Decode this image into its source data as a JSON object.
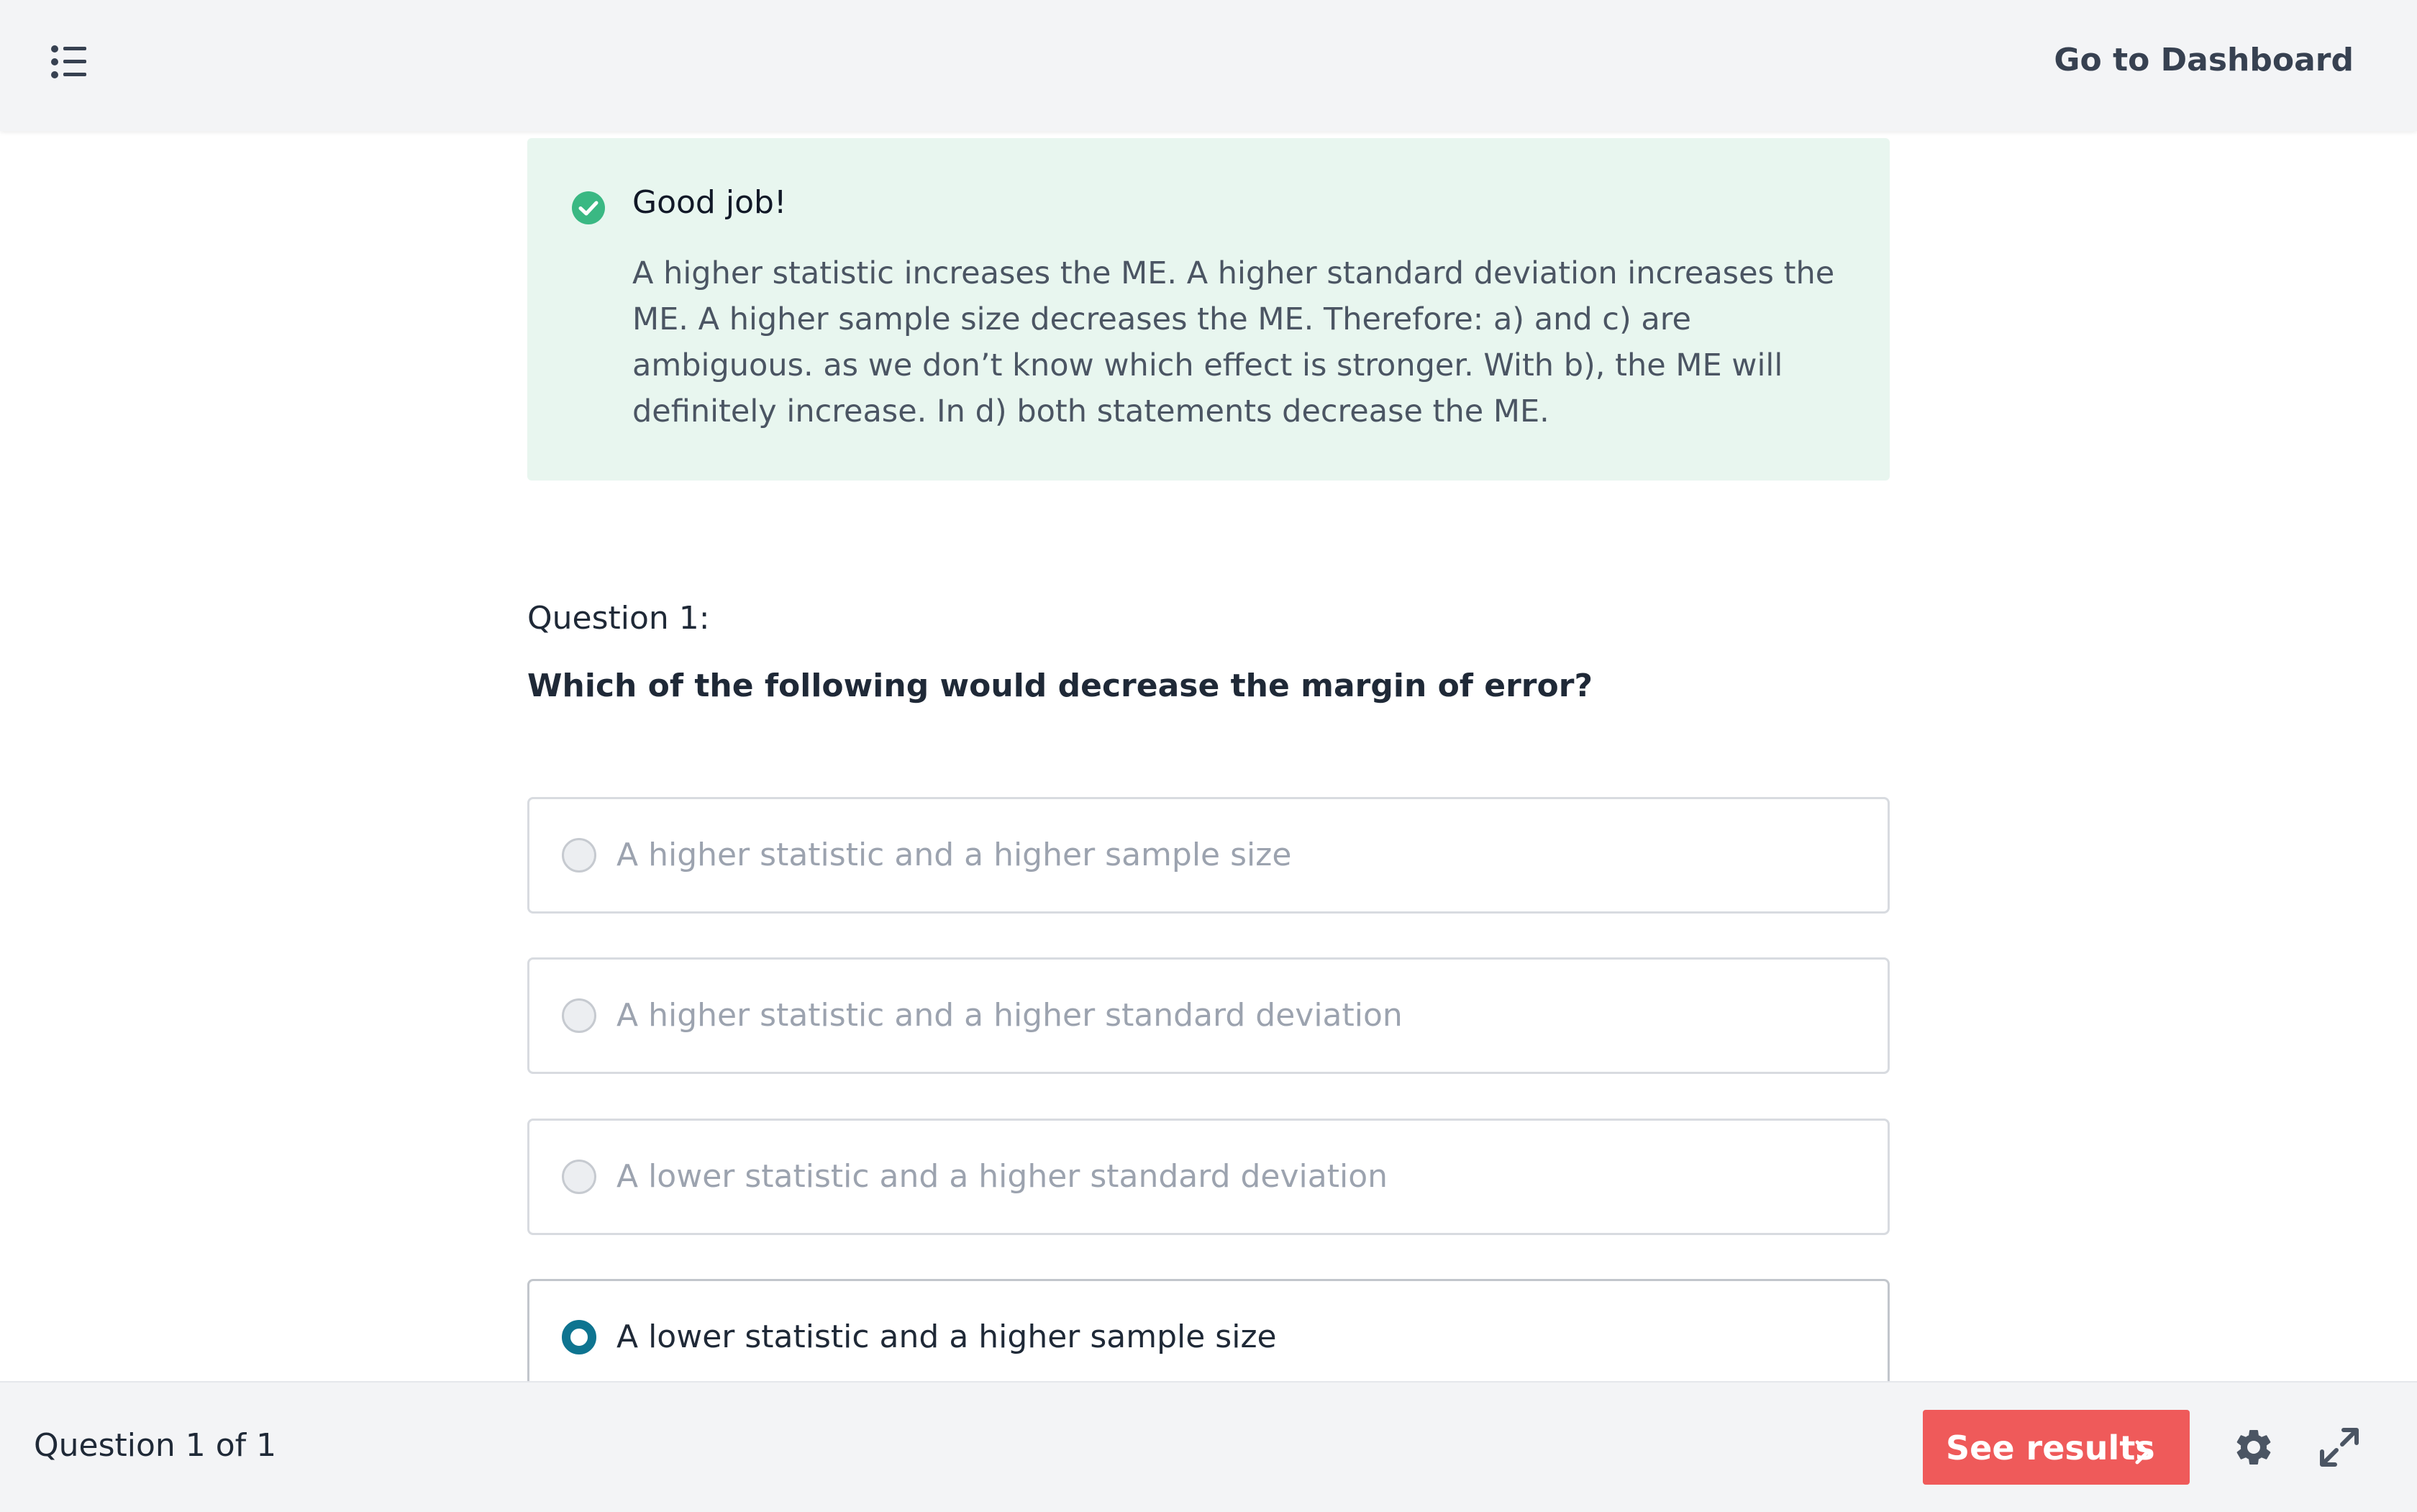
{
  "header": {
    "menu_icon": "list-icon",
    "dashboard_link": "Go to Dashboard"
  },
  "feedback": {
    "icon": "check-circle-icon",
    "title": "Good job!",
    "text": "A higher statistic increases the ME. A higher standard deviation increases the ME. A higher sample size decreases the ME. Therefore: a) and c) are ambiguous. as we don’t know which effect is stronger. With b), the ME will definitely increase. In d) both statements decrease the ME.",
    "color": "#e8f6ef",
    "icon_color": "#3ab883"
  },
  "question": {
    "label": "Question 1:",
    "text": "Which of the following would decrease the margin of error?",
    "options": [
      {
        "label": "A higher statistic and a higher sample size",
        "selected": false
      },
      {
        "label": "A higher statistic and a higher standard deviation",
        "selected": false
      },
      {
        "label": "A lower statistic and a higher standard deviation",
        "selected": false
      },
      {
        "label": "A lower statistic and a higher sample size",
        "selected": true
      }
    ],
    "selected_color": "#0e7490"
  },
  "footer": {
    "counter": "Question 1 of 1",
    "results_button": "See results",
    "results_icon": "chevron-right-icon",
    "results_color": "#ef5a5a",
    "settings_icon": "gear-icon",
    "expand_icon": "expand-icon"
  }
}
